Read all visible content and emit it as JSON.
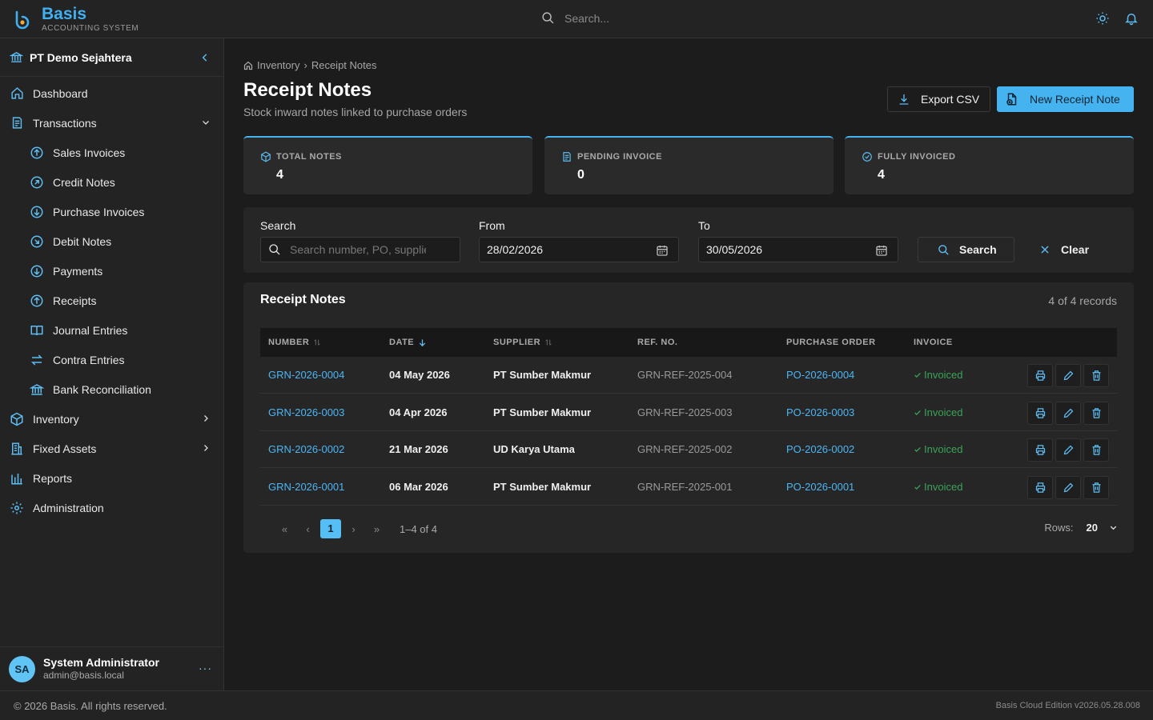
{
  "app": {
    "title": "Basis",
    "subtitle": "ACCOUNTING SYSTEM",
    "search_placeholder": "Search..."
  },
  "sidebar": {
    "company": "PT Demo Sejahtera",
    "items": [
      {
        "label": "Dashboard",
        "icon": "home-icon"
      },
      {
        "label": "Transactions",
        "icon": "receipt-icon"
      },
      {
        "label": "Sales Invoices",
        "icon": "arrow-up-circle-icon"
      },
      {
        "label": "Credit Notes",
        "icon": "arrow-up-right-circle-icon"
      },
      {
        "label": "Purchase Invoices",
        "icon": "arrow-down-circle-icon"
      },
      {
        "label": "Debit Notes",
        "icon": "arrow-down-right-circle-icon"
      },
      {
        "label": "Payments",
        "icon": "arrow-down-circle-icon"
      },
      {
        "label": "Receipts",
        "icon": "arrow-up-circle-icon"
      },
      {
        "label": "Journal Entries",
        "icon": "book-icon"
      },
      {
        "label": "Contra Entries",
        "icon": "swap-icon"
      },
      {
        "label": "Bank Reconciliation",
        "icon": "bank-icon"
      },
      {
        "label": "Inventory",
        "icon": "box-icon"
      },
      {
        "label": "Fixed Assets",
        "icon": "building-icon"
      },
      {
        "label": "Reports",
        "icon": "bar-chart-icon"
      },
      {
        "label": "Administration",
        "icon": "gear-icon"
      }
    ],
    "user": {
      "initials": "SA",
      "name": "System Administrator",
      "email": "admin@basis.local",
      "more": "···"
    }
  },
  "breadcrumb": {
    "parent": "Inventory",
    "sep": "›",
    "current": "Receipt Notes"
  },
  "page": {
    "title": "Receipt Notes",
    "subtitle": "Stock inward notes linked to purchase orders"
  },
  "actions": {
    "export": "Export CSV",
    "new": "New Receipt Note"
  },
  "stats": [
    {
      "label": "TOTAL NOTES",
      "value": "4"
    },
    {
      "label": "PENDING INVOICE",
      "value": "0"
    },
    {
      "label": "FULLY INVOICED",
      "value": "4"
    }
  ],
  "filter": {
    "search_label": "Search",
    "search_placeholder": "Search number, PO, supplier",
    "from_label": "From",
    "from_value": "28/02/2026",
    "to_label": "To",
    "to_value": "30/05/2026",
    "search_button": "Search",
    "clear_button": "Clear"
  },
  "table": {
    "title": "Receipt Notes",
    "count": "4 of 4 records",
    "columns": [
      "NUMBER",
      "DATE",
      "SUPPLIER",
      "REF. NO.",
      "PURCHASE ORDER",
      "INVOICE"
    ],
    "rows": [
      {
        "number": "GRN-2026-0004",
        "date": "04 May 2026",
        "supplier": "PT Sumber Makmur",
        "ref": "GRN-REF-2025-004",
        "po": "PO-2026-0004",
        "invoice": "Invoiced"
      },
      {
        "number": "GRN-2026-0003",
        "date": "04 Apr 2026",
        "supplier": "PT Sumber Makmur",
        "ref": "GRN-REF-2025-003",
        "po": "PO-2026-0003",
        "invoice": "Invoiced"
      },
      {
        "number": "GRN-2026-0002",
        "date": "21 Mar 2026",
        "supplier": "UD Karya Utama",
        "ref": "GRN-REF-2025-002",
        "po": "PO-2026-0002",
        "invoice": "Invoiced"
      },
      {
        "number": "GRN-2026-0001",
        "date": "06 Mar 2026",
        "supplier": "PT Sumber Makmur",
        "ref": "GRN-REF-2025-001",
        "po": "PO-2026-0001",
        "invoice": "Invoiced"
      }
    ],
    "pager": {
      "first": "«",
      "prev": "‹",
      "current": "1",
      "next": "›",
      "last": "»",
      "info": "1–4 of 4",
      "rows_label": "Rows:",
      "rows_value": "20"
    }
  },
  "footer": {
    "copyright": "© 2026 Basis. All rights reserved.",
    "version": "Basis Cloud Edition v2026.05.28.008"
  },
  "colors": {
    "accent": "#45b3f0",
    "success": "#3aa358",
    "background": "#1c1c1c",
    "panel": "#262626"
  }
}
